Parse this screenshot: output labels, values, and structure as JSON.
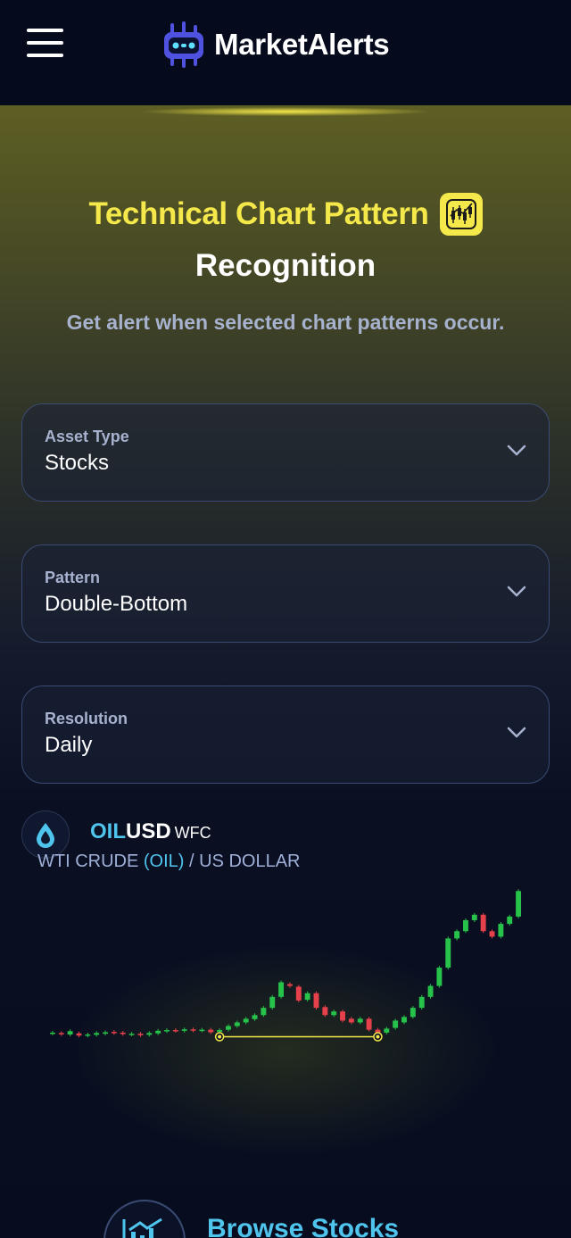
{
  "header": {
    "app_name": "MarketAlerts",
    "menu_icon": "hamburger-menu-icon",
    "logo_icon": "robot-logo-icon"
  },
  "hero": {
    "title_highlight": "Technical Chart Pattern",
    "title_rest": "Recognition",
    "title_icon": "candlestick-chart-icon",
    "subtitle": "Get alert when selected chart patterns occur."
  },
  "selects": [
    {
      "label": "Asset Type",
      "value": "Stocks"
    },
    {
      "label": "Pattern",
      "value": "Double-Bottom"
    },
    {
      "label": "Resolution",
      "value": "Daily"
    }
  ],
  "asset": {
    "icon": "oil-drop-icon",
    "ticker_part1": "OIL",
    "ticker_part2": "USD",
    "exchange": "WFC",
    "name_prefix": "WTI CRUDE",
    "name_highlight": "(OIL)",
    "name_suffix": "/ US DOLLAR"
  },
  "chart_data": {
    "type": "candlestick",
    "pattern": "Double-Bottom",
    "colors": {
      "up": "#27c24a",
      "down": "#e5414b",
      "pattern": "#f4e84a"
    },
    "candles": [
      {
        "o": 3.0,
        "c": 3.2
      },
      {
        "o": 3.1,
        "c": 2.8
      },
      {
        "o": 2.7,
        "c": 3.6
      },
      {
        "o": 3.0,
        "c": 2.4
      },
      {
        "o": 2.4,
        "c": 2.7
      },
      {
        "o": 2.6,
        "c": 3.1
      },
      {
        "o": 2.9,
        "c": 3.3
      },
      {
        "o": 3.4,
        "c": 3.1
      },
      {
        "o": 3.2,
        "c": 2.8
      },
      {
        "o": 2.7,
        "c": 2.9
      },
      {
        "o": 2.9,
        "c": 2.5
      },
      {
        "o": 2.6,
        "c": 3.1
      },
      {
        "o": 3.0,
        "c": 3.7
      },
      {
        "o": 3.6,
        "c": 3.9
      },
      {
        "o": 3.9,
        "c": 3.7
      },
      {
        "o": 3.7,
        "c": 4.1
      },
      {
        "o": 4.1,
        "c": 3.8
      },
      {
        "o": 3.8,
        "c": 4.0
      },
      {
        "o": 4.0,
        "c": 3.3
      },
      {
        "o": 3.4,
        "c": 3.9
      },
      {
        "o": 4.0,
        "c": 5.0
      },
      {
        "o": 5.0,
        "c": 6.0
      },
      {
        "o": 6.0,
        "c": 7.0
      },
      {
        "o": 6.9,
        "c": 8.0
      },
      {
        "o": 8.0,
        "c": 10.0
      },
      {
        "o": 10.0,
        "c": 13.0
      },
      {
        "o": 13.0,
        "c": 17.0
      },
      {
        "o": 16.5,
        "c": 16.0
      },
      {
        "o": 15.8,
        "c": 12.0
      },
      {
        "o": 12.2,
        "c": 14.0
      },
      {
        "o": 14.0,
        "c": 10.0
      },
      {
        "o": 10.2,
        "c": 8.0
      },
      {
        "o": 8.0,
        "c": 9.0
      },
      {
        "o": 9.0,
        "c": 6.5
      },
      {
        "o": 7.0,
        "c": 6.0
      },
      {
        "o": 6.0,
        "c": 7.0
      },
      {
        "o": 7.0,
        "c": 4.0
      },
      {
        "o": 4.0,
        "c": 2.8
      },
      {
        "o": 3.2,
        "c": 4.3
      },
      {
        "o": 4.5,
        "c": 6.5
      },
      {
        "o": 6.0,
        "c": 7.5
      },
      {
        "o": 7.5,
        "c": 10.0
      },
      {
        "o": 10.0,
        "c": 13.0
      },
      {
        "o": 13.0,
        "c": 16.0
      },
      {
        "o": 16.0,
        "c": 21.0
      },
      {
        "o": 21.0,
        "c": 29.0
      },
      {
        "o": 29.0,
        "c": 31.0
      },
      {
        "o": 31.0,
        "c": 34.0
      },
      {
        "o": 34.0,
        "c": 35.5
      },
      {
        "o": 35.5,
        "c": 31.0
      },
      {
        "o": 31.0,
        "c": 29.5
      },
      {
        "o": 29.5,
        "c": 33.0
      },
      {
        "o": 33.0,
        "c": 35.0
      },
      {
        "o": 35.0,
        "c": 42.0
      }
    ],
    "pattern_points": [
      {
        "index": 19,
        "value": 3.3
      },
      {
        "index": 37,
        "value": 3.3
      }
    ],
    "grid": false,
    "legend": "none"
  },
  "browse": {
    "label": "Browse Stocks",
    "icon": "stock-chart-icon"
  }
}
